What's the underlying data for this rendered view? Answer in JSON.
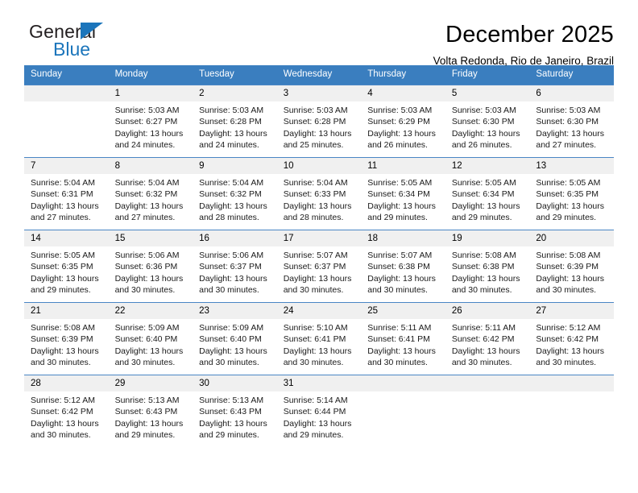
{
  "brand": {
    "name_part1": "General",
    "name_part2": "Blue",
    "accent_color": "#1b75bb",
    "triangle_icon": "triangle-icon"
  },
  "header": {
    "title": "December 2025",
    "subtitle": "Volta Redonda, Rio de Janeiro, Brazil"
  },
  "calendar": {
    "header_bg": "#3a7ebf",
    "daynum_bg": "#f0f0f0",
    "weekdays": [
      "Sunday",
      "Monday",
      "Tuesday",
      "Wednesday",
      "Thursday",
      "Friday",
      "Saturday"
    ],
    "weeks": [
      [
        {
          "day": "",
          "sunrise": "",
          "sunset": "",
          "daylight_line1": "",
          "daylight_line2": ""
        },
        {
          "day": "1",
          "sunrise": "Sunrise: 5:03 AM",
          "sunset": "Sunset: 6:27 PM",
          "daylight_line1": "Daylight: 13 hours",
          "daylight_line2": "and 24 minutes."
        },
        {
          "day": "2",
          "sunrise": "Sunrise: 5:03 AM",
          "sunset": "Sunset: 6:28 PM",
          "daylight_line1": "Daylight: 13 hours",
          "daylight_line2": "and 24 minutes."
        },
        {
          "day": "3",
          "sunrise": "Sunrise: 5:03 AM",
          "sunset": "Sunset: 6:28 PM",
          "daylight_line1": "Daylight: 13 hours",
          "daylight_line2": "and 25 minutes."
        },
        {
          "day": "4",
          "sunrise": "Sunrise: 5:03 AM",
          "sunset": "Sunset: 6:29 PM",
          "daylight_line1": "Daylight: 13 hours",
          "daylight_line2": "and 26 minutes."
        },
        {
          "day": "5",
          "sunrise": "Sunrise: 5:03 AM",
          "sunset": "Sunset: 6:30 PM",
          "daylight_line1": "Daylight: 13 hours",
          "daylight_line2": "and 26 minutes."
        },
        {
          "day": "6",
          "sunrise": "Sunrise: 5:03 AM",
          "sunset": "Sunset: 6:30 PM",
          "daylight_line1": "Daylight: 13 hours",
          "daylight_line2": "and 27 minutes."
        }
      ],
      [
        {
          "day": "7",
          "sunrise": "Sunrise: 5:04 AM",
          "sunset": "Sunset: 6:31 PM",
          "daylight_line1": "Daylight: 13 hours",
          "daylight_line2": "and 27 minutes."
        },
        {
          "day": "8",
          "sunrise": "Sunrise: 5:04 AM",
          "sunset": "Sunset: 6:32 PM",
          "daylight_line1": "Daylight: 13 hours",
          "daylight_line2": "and 27 minutes."
        },
        {
          "day": "9",
          "sunrise": "Sunrise: 5:04 AM",
          "sunset": "Sunset: 6:32 PM",
          "daylight_line1": "Daylight: 13 hours",
          "daylight_line2": "and 28 minutes."
        },
        {
          "day": "10",
          "sunrise": "Sunrise: 5:04 AM",
          "sunset": "Sunset: 6:33 PM",
          "daylight_line1": "Daylight: 13 hours",
          "daylight_line2": "and 28 minutes."
        },
        {
          "day": "11",
          "sunrise": "Sunrise: 5:05 AM",
          "sunset": "Sunset: 6:34 PM",
          "daylight_line1": "Daylight: 13 hours",
          "daylight_line2": "and 29 minutes."
        },
        {
          "day": "12",
          "sunrise": "Sunrise: 5:05 AM",
          "sunset": "Sunset: 6:34 PM",
          "daylight_line1": "Daylight: 13 hours",
          "daylight_line2": "and 29 minutes."
        },
        {
          "day": "13",
          "sunrise": "Sunrise: 5:05 AM",
          "sunset": "Sunset: 6:35 PM",
          "daylight_line1": "Daylight: 13 hours",
          "daylight_line2": "and 29 minutes."
        }
      ],
      [
        {
          "day": "14",
          "sunrise": "Sunrise: 5:05 AM",
          "sunset": "Sunset: 6:35 PM",
          "daylight_line1": "Daylight: 13 hours",
          "daylight_line2": "and 29 minutes."
        },
        {
          "day": "15",
          "sunrise": "Sunrise: 5:06 AM",
          "sunset": "Sunset: 6:36 PM",
          "daylight_line1": "Daylight: 13 hours",
          "daylight_line2": "and 30 minutes."
        },
        {
          "day": "16",
          "sunrise": "Sunrise: 5:06 AM",
          "sunset": "Sunset: 6:37 PM",
          "daylight_line1": "Daylight: 13 hours",
          "daylight_line2": "and 30 minutes."
        },
        {
          "day": "17",
          "sunrise": "Sunrise: 5:07 AM",
          "sunset": "Sunset: 6:37 PM",
          "daylight_line1": "Daylight: 13 hours",
          "daylight_line2": "and 30 minutes."
        },
        {
          "day": "18",
          "sunrise": "Sunrise: 5:07 AM",
          "sunset": "Sunset: 6:38 PM",
          "daylight_line1": "Daylight: 13 hours",
          "daylight_line2": "and 30 minutes."
        },
        {
          "day": "19",
          "sunrise": "Sunrise: 5:08 AM",
          "sunset": "Sunset: 6:38 PM",
          "daylight_line1": "Daylight: 13 hours",
          "daylight_line2": "and 30 minutes."
        },
        {
          "day": "20",
          "sunrise": "Sunrise: 5:08 AM",
          "sunset": "Sunset: 6:39 PM",
          "daylight_line1": "Daylight: 13 hours",
          "daylight_line2": "and 30 minutes."
        }
      ],
      [
        {
          "day": "21",
          "sunrise": "Sunrise: 5:08 AM",
          "sunset": "Sunset: 6:39 PM",
          "daylight_line1": "Daylight: 13 hours",
          "daylight_line2": "and 30 minutes."
        },
        {
          "day": "22",
          "sunrise": "Sunrise: 5:09 AM",
          "sunset": "Sunset: 6:40 PM",
          "daylight_line1": "Daylight: 13 hours",
          "daylight_line2": "and 30 minutes."
        },
        {
          "day": "23",
          "sunrise": "Sunrise: 5:09 AM",
          "sunset": "Sunset: 6:40 PM",
          "daylight_line1": "Daylight: 13 hours",
          "daylight_line2": "and 30 minutes."
        },
        {
          "day": "24",
          "sunrise": "Sunrise: 5:10 AM",
          "sunset": "Sunset: 6:41 PM",
          "daylight_line1": "Daylight: 13 hours",
          "daylight_line2": "and 30 minutes."
        },
        {
          "day": "25",
          "sunrise": "Sunrise: 5:11 AM",
          "sunset": "Sunset: 6:41 PM",
          "daylight_line1": "Daylight: 13 hours",
          "daylight_line2": "and 30 minutes."
        },
        {
          "day": "26",
          "sunrise": "Sunrise: 5:11 AM",
          "sunset": "Sunset: 6:42 PM",
          "daylight_line1": "Daylight: 13 hours",
          "daylight_line2": "and 30 minutes."
        },
        {
          "day": "27",
          "sunrise": "Sunrise: 5:12 AM",
          "sunset": "Sunset: 6:42 PM",
          "daylight_line1": "Daylight: 13 hours",
          "daylight_line2": "and 30 minutes."
        }
      ],
      [
        {
          "day": "28",
          "sunrise": "Sunrise: 5:12 AM",
          "sunset": "Sunset: 6:42 PM",
          "daylight_line1": "Daylight: 13 hours",
          "daylight_line2": "and 30 minutes."
        },
        {
          "day": "29",
          "sunrise": "Sunrise: 5:13 AM",
          "sunset": "Sunset: 6:43 PM",
          "daylight_line1": "Daylight: 13 hours",
          "daylight_line2": "and 29 minutes."
        },
        {
          "day": "30",
          "sunrise": "Sunrise: 5:13 AM",
          "sunset": "Sunset: 6:43 PM",
          "daylight_line1": "Daylight: 13 hours",
          "daylight_line2": "and 29 minutes."
        },
        {
          "day": "31",
          "sunrise": "Sunrise: 5:14 AM",
          "sunset": "Sunset: 6:44 PM",
          "daylight_line1": "Daylight: 13 hours",
          "daylight_line2": "and 29 minutes."
        },
        {
          "day": "",
          "sunrise": "",
          "sunset": "",
          "daylight_line1": "",
          "daylight_line2": ""
        },
        {
          "day": "",
          "sunrise": "",
          "sunset": "",
          "daylight_line1": "",
          "daylight_line2": ""
        },
        {
          "day": "",
          "sunrise": "",
          "sunset": "",
          "daylight_line1": "",
          "daylight_line2": ""
        }
      ]
    ]
  }
}
